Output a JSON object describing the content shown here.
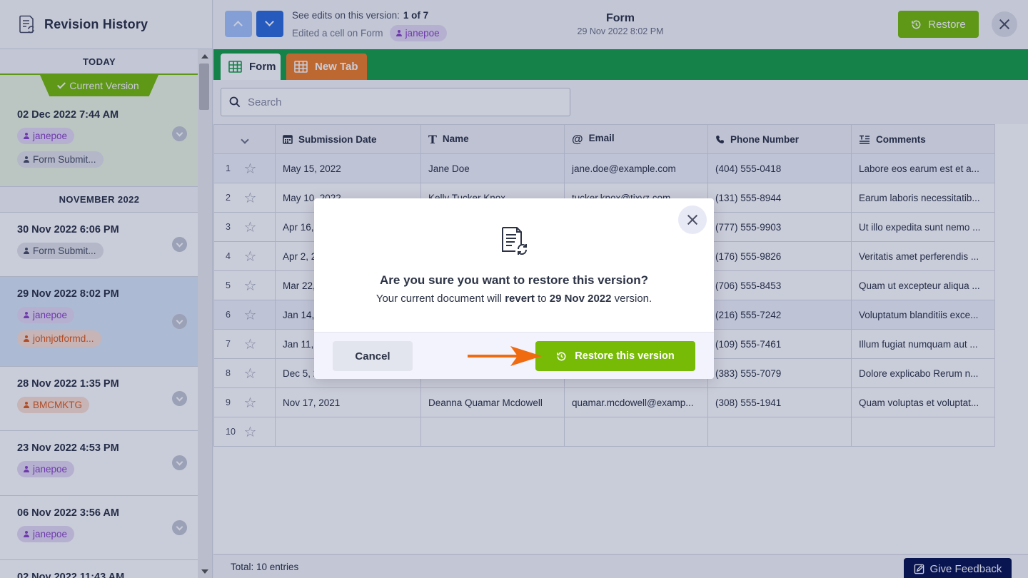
{
  "sidebar": {
    "title": "Revision History",
    "today_label": "TODAY",
    "current_version_label": "Current Version",
    "november_label": "NOVEMBER 2022",
    "revisions": [
      {
        "date": "02 Dec 2022 7:44 AM",
        "chips": [
          {
            "text": "janepoe",
            "style": "purple"
          },
          {
            "text": "Form Submit...",
            "style": "gray"
          }
        ]
      },
      {
        "date": "30 Nov 2022 6:06 PM",
        "chips": [
          {
            "text": "Form Submit...",
            "style": "gray"
          }
        ]
      },
      {
        "date": "29 Nov 2022 8:02 PM",
        "chips": [
          {
            "text": "janepoe",
            "style": "purple"
          },
          {
            "text": "johnjotformd...",
            "style": "orange"
          }
        ]
      },
      {
        "date": "28 Nov 2022 1:35 PM",
        "chips": [
          {
            "text": "BMCMKTG",
            "style": "orange"
          }
        ]
      },
      {
        "date": "23 Nov 2022 4:53 PM",
        "chips": [
          {
            "text": "janepoe",
            "style": "purple"
          }
        ]
      },
      {
        "date": "06 Nov 2022 3:56 AM",
        "chips": [
          {
            "text": "janepoe",
            "style": "purple"
          }
        ]
      },
      {
        "date": "02 Nov 2022 11:43 AM",
        "chips": []
      }
    ]
  },
  "topbar": {
    "see_edits_label": "See edits on this version:",
    "edit_count": "1 of 7",
    "edited_text": "Edited a cell on Form",
    "edited_by": "janepoe",
    "doc_name": "Form",
    "doc_timestamp": "29 Nov 2022 8:02 PM",
    "restore_label": "Restore"
  },
  "tabs": [
    {
      "label": "Form"
    },
    {
      "label": "New Tab"
    }
  ],
  "search": {
    "placeholder": "Search"
  },
  "table": {
    "columns": [
      {
        "label": "Submission Date",
        "icon": "calendar-icon"
      },
      {
        "label": "Name",
        "icon": "text-icon"
      },
      {
        "label": "Email",
        "icon": "at-icon"
      },
      {
        "label": "Phone Number",
        "icon": "phone-icon"
      },
      {
        "label": "Comments",
        "icon": "long-text-icon"
      }
    ],
    "rows": [
      {
        "num": "1",
        "cells": [
          "May 15, 2022",
          "Jane Doe",
          "jane.doe@example.com",
          "(404) 555-0418",
          "Labore eos earum est et a..."
        ]
      },
      {
        "num": "2",
        "cells": [
          "May 10, 2022",
          "Kelly Tucker Knox",
          "tucker.knox@tixyz.com",
          "(131) 555-8944",
          "Earum laboris necessitatib..."
        ]
      },
      {
        "num": "3",
        "cells": [
          "Apr 16, 2022",
          "",
          "",
          "(777) 555-9903",
          "Ut illo expedita sunt nemo ..."
        ]
      },
      {
        "num": "4",
        "cells": [
          "Apr 2, 2022",
          "",
          "",
          "(176) 555-9826",
          "Veritatis amet perferendis ..."
        ]
      },
      {
        "num": "5",
        "cells": [
          "Mar 22, 2022",
          "",
          "",
          "(706) 555-8453",
          "Quam ut excepteur aliqua ..."
        ]
      },
      {
        "num": "6",
        "cells": [
          "Jan 14, 2022",
          "",
          "",
          "(216) 555-7242",
          "Voluptatum blanditiis exce..."
        ]
      },
      {
        "num": "7",
        "cells": [
          "Jan 11, 2022",
          "",
          "",
          "(109) 555-7461",
          "Illum fugiat numquam aut ..."
        ]
      },
      {
        "num": "8",
        "cells": [
          "Dec 5, 2021",
          "",
          "",
          "(383) 555-7079",
          "Dolore explicabo Rerum n..."
        ]
      },
      {
        "num": "9",
        "cells": [
          "Nov 17, 2021",
          "Deanna Quamar Mcdowell",
          "quamar.mcdowell@examp...",
          "(308) 555-1941",
          "Quam voluptas et voluptat..."
        ]
      },
      {
        "num": "10",
        "cells": [
          "",
          "",
          "",
          "",
          ""
        ]
      }
    ]
  },
  "footer": {
    "total": "Total: 10 entries"
  },
  "feedback_label": "Give Feedback",
  "modal": {
    "question": "Are you sure you want to restore this version?",
    "sub_before": "Your current document will",
    "sub_revert": "revert",
    "sub_to": "to",
    "sub_date": "29 Nov 2022",
    "sub_after": "version.",
    "cancel_label": "Cancel",
    "confirm_label": "Restore this version"
  },
  "colors": {
    "green": "#78bb07",
    "tab_bar": "#18a047",
    "orange_tab": "#f07f28",
    "navy": "#0a1551",
    "blue": "#2f6edb",
    "arrow": "#f06a10"
  }
}
